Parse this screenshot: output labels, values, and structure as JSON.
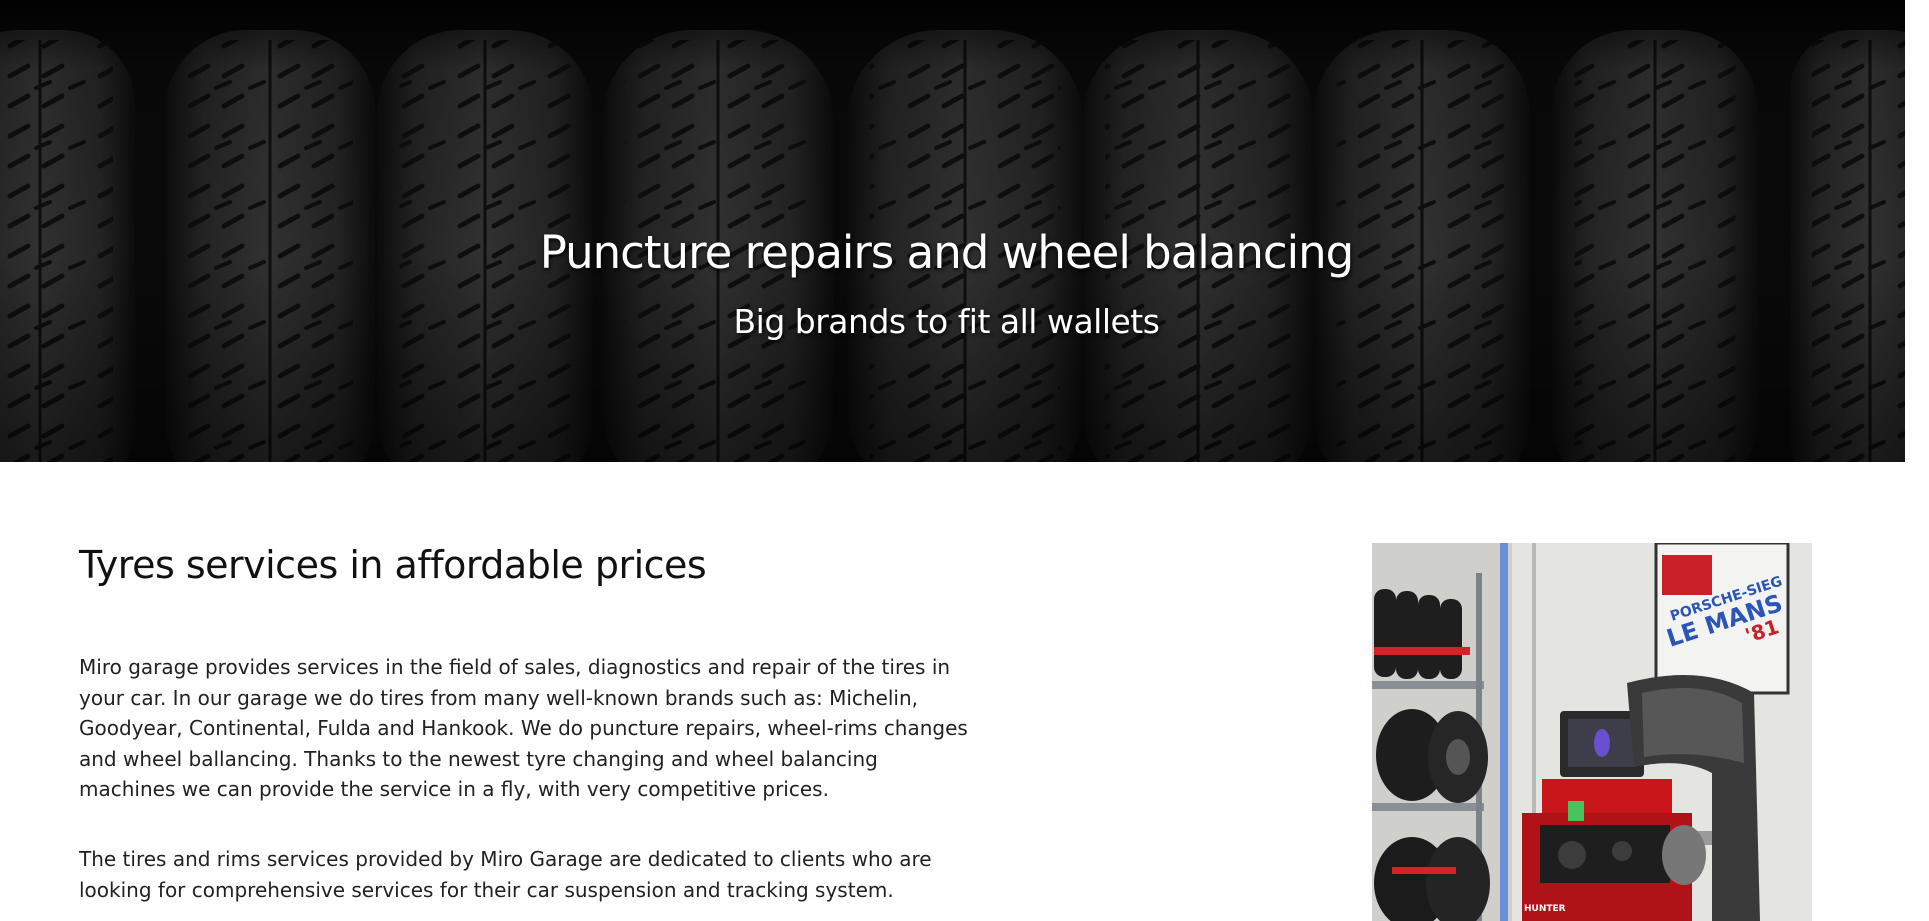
{
  "hero": {
    "title": "Puncture repairs and wheel balancing",
    "subtitle": "Big brands to fit all wallets"
  },
  "content": {
    "heading": "Tyres services in affordable prices",
    "paragraph_1": "Miro garage provides services in the field of sales, diagnostics and repair of the tires in your car. In our garage we do tires from many well-known brands such as: Michelin, Goodyear, Continental, Fulda and Hankook. We do puncture repairs, wheel-rims changes and wheel ballancing. Thanks to the newest tyre changing and wheel balancing machines we can provide the service in a fly, with very competitive prices.",
    "paragraph_2": "The tires and rims services provided by Miro Garage are dedicated to clients who are looking for comprehensive services for their car suspension and tracking system."
  },
  "photo": {
    "poster_line_1": "PORSCHE-SIEG",
    "poster_line_2": "LE MANS",
    "poster_line_3": "'81",
    "machine_label": "HUNTER"
  },
  "colors": {
    "hero_background": "#0b0b0b",
    "tyre": "#242424",
    "machine_red": "#c8161b",
    "text": "#222222"
  }
}
